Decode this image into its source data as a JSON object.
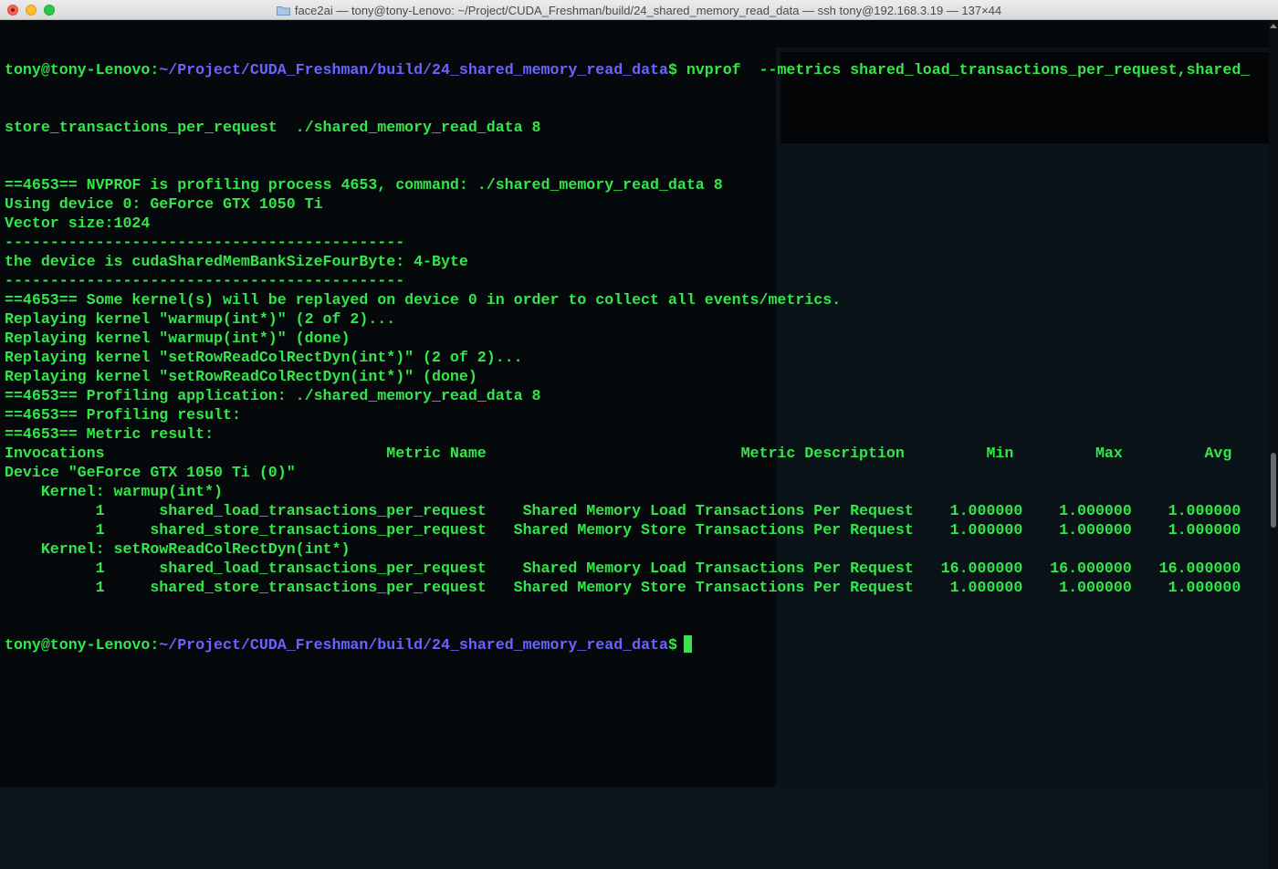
{
  "window": {
    "title": "face2ai — tony@tony-Lenovo: ~/Project/CUDA_Freshman/build/24_shared_memory_read_data — ssh tony@192.168.3.19 — 137×44"
  },
  "prompt": {
    "user_host": "tony@tony-Lenovo",
    "separator": ":",
    "path": "~/Project/CUDA_Freshman/build/24_shared_memory_read_data",
    "symbol": "$"
  },
  "command": {
    "text": " nvprof  --metrics shared_load_transactions_per_request,shared_",
    "continuation": "store_transactions_per_request  ./shared_memory_read_data 8"
  },
  "output": [
    "==4653== NVPROF is profiling process 4653, command: ./shared_memory_read_data 8",
    "Using device 0: GeForce GTX 1050 Ti",
    "Vector size:1024",
    "--------------------------------------------",
    "the device is cudaSharedMemBankSizeFourByte: 4-Byte",
    "--------------------------------------------",
    "==4653== Some kernel(s) will be replayed on device 0 in order to collect all events/metrics.",
    "Replaying kernel \"warmup(int*)\" (2 of 2)...",
    "Replaying kernel \"warmup(int*)\" (done)",
    "Replaying kernel \"setRowReadColRectDyn(int*)\" (2 of 2)...",
    "Replaying kernel \"setRowReadColRectDyn(int*)\" (done)",
    "==4653== Profiling application: ./shared_memory_read_data 8",
    "==4653== Profiling result:",
    "==4653== Metric result:",
    "Invocations                               Metric Name                            Metric Description         Min         Max         Avg",
    "Device \"GeForce GTX 1050 Ti (0)\"",
    "    Kernel: warmup(int*)",
    "          1      shared_load_transactions_per_request    Shared Memory Load Transactions Per Request    1.000000    1.000000    1.000000",
    "          1     shared_store_transactions_per_request   Shared Memory Store Transactions Per Request    1.000000    1.000000    1.000000",
    "    Kernel: setRowReadColRectDyn(int*)",
    "          1      shared_load_transactions_per_request    Shared Memory Load Transactions Per Request   16.000000   16.000000   16.000000",
    "          1     shared_store_transactions_per_request   Shared Memory Store Transactions Per Request    1.000000    1.000000    1.000000"
  ],
  "colors": {
    "terminal_text": "#35e64a",
    "prompt_path": "#6b63ff",
    "background": "#05090c"
  }
}
